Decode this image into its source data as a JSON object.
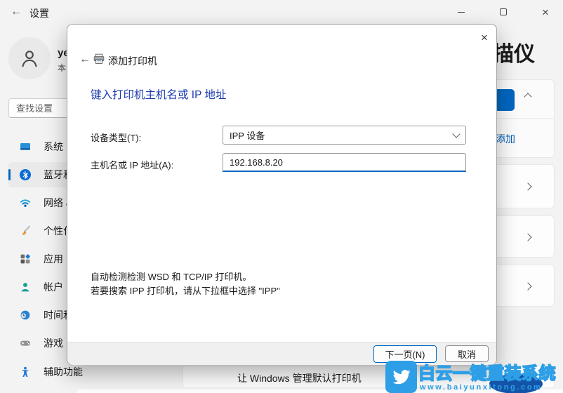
{
  "colors": {
    "accent": "#0067c0",
    "wizard_heading_blue": "#1c3bb0",
    "watermark_blue": "#2e9fe6",
    "watermark_dark_blue": "#1254a8"
  },
  "titlebar": {
    "title": "设置"
  },
  "sidebar": {
    "user_name": "ye",
    "user_sub": "本",
    "search_placeholder": "查找设置",
    "items": [
      {
        "label": "系统"
      },
      {
        "label": "蓝牙和"
      },
      {
        "label": "网络 &"
      },
      {
        "label": "个性化"
      },
      {
        "label": "应用"
      },
      {
        "label": "帐户"
      },
      {
        "label": "时间和"
      },
      {
        "label": "游戏"
      },
      {
        "label": "辅助功能"
      }
    ]
  },
  "background_page": {
    "title_fragment": "描仪",
    "add_link": "添加",
    "manage_default_printer": "让 Windows 管理默认打印机"
  },
  "dialog": {
    "title": "添加打印机",
    "heading": "键入打印机主机名或 IP 地址",
    "device_type_label": "设备类型(T):",
    "device_type_value": "IPP 设备",
    "hostname_label": "主机名或 IP 地址(A):",
    "hostname_value": "192.168.8.20",
    "hint_line1": "自动检测检测 WSD 和 TCP/IP 打印机。",
    "hint_line2": "若要搜索 IPP 打印机，请从下拉框中选择 \"IPP\"",
    "next_button": "下一页(N)",
    "cancel_button": "取消"
  },
  "watermark": {
    "brand": "白云一键重装系统",
    "url": "www.baiyunxitong.com"
  }
}
